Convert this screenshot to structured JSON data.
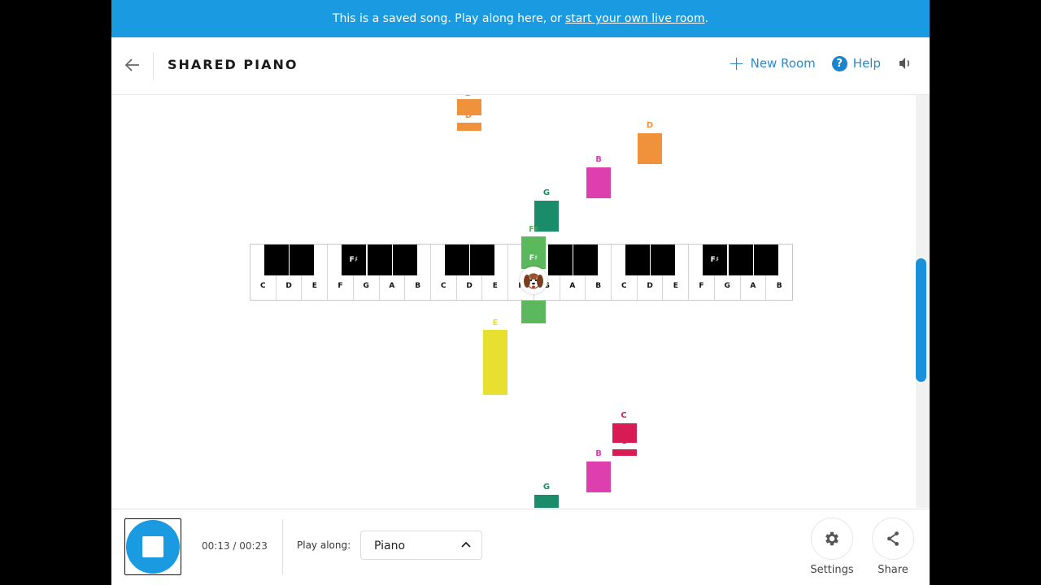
{
  "banner": {
    "text": "This is a saved song. Play along here, or",
    "link": "start your own live room",
    "suffix": "."
  },
  "header": {
    "title": "SHARED PIANO",
    "new_room": "New Room",
    "help": "Help",
    "help_glyph": "?",
    "icons": {
      "back": "arrow-left-icon",
      "new_room": "plus-icon",
      "help": "question-circle-icon",
      "sound": "speaker-icon"
    }
  },
  "piano": {
    "white_keys": [
      "C",
      "D",
      "E",
      "F",
      "G",
      "A",
      "B",
      "C",
      "D",
      "E",
      "F",
      "G",
      "A",
      "B",
      "C",
      "D",
      "E",
      "F",
      "G",
      "A",
      "B"
    ],
    "black_key_labels": {
      "F#_1": "F♯",
      "F#_2": "F♯",
      "F#_3": "F♯"
    },
    "active_note": "F♯",
    "avatar": "dog-avatar"
  },
  "notes": [
    {
      "label": "D",
      "color": "#f0913c"
    },
    {
      "label": "D",
      "color": "#f0913c"
    },
    {
      "label": "D",
      "color": "#f0913c"
    },
    {
      "label": "B",
      "color": "#de3fae"
    },
    {
      "label": "G",
      "color": "#1a8c6a"
    },
    {
      "label": "F♯",
      "color": "#5cb85c"
    },
    {
      "label": "F♯",
      "color": "#5cb85c"
    },
    {
      "label": "E",
      "color": "#e8e030"
    },
    {
      "label": "C",
      "color": "#d81b55"
    },
    {
      "label": "C",
      "color": "#d81b55"
    },
    {
      "label": "B",
      "color": "#de3fae"
    },
    {
      "label": "G",
      "color": "#1a8c6a"
    }
  ],
  "player": {
    "time": "00:13 / 00:23",
    "play_along_label": "Play along:",
    "instrument": "Piano",
    "settings": "Settings",
    "share": "Share"
  },
  "colors": {
    "accent": "#1a9ae0",
    "link": "#2a8acb"
  }
}
